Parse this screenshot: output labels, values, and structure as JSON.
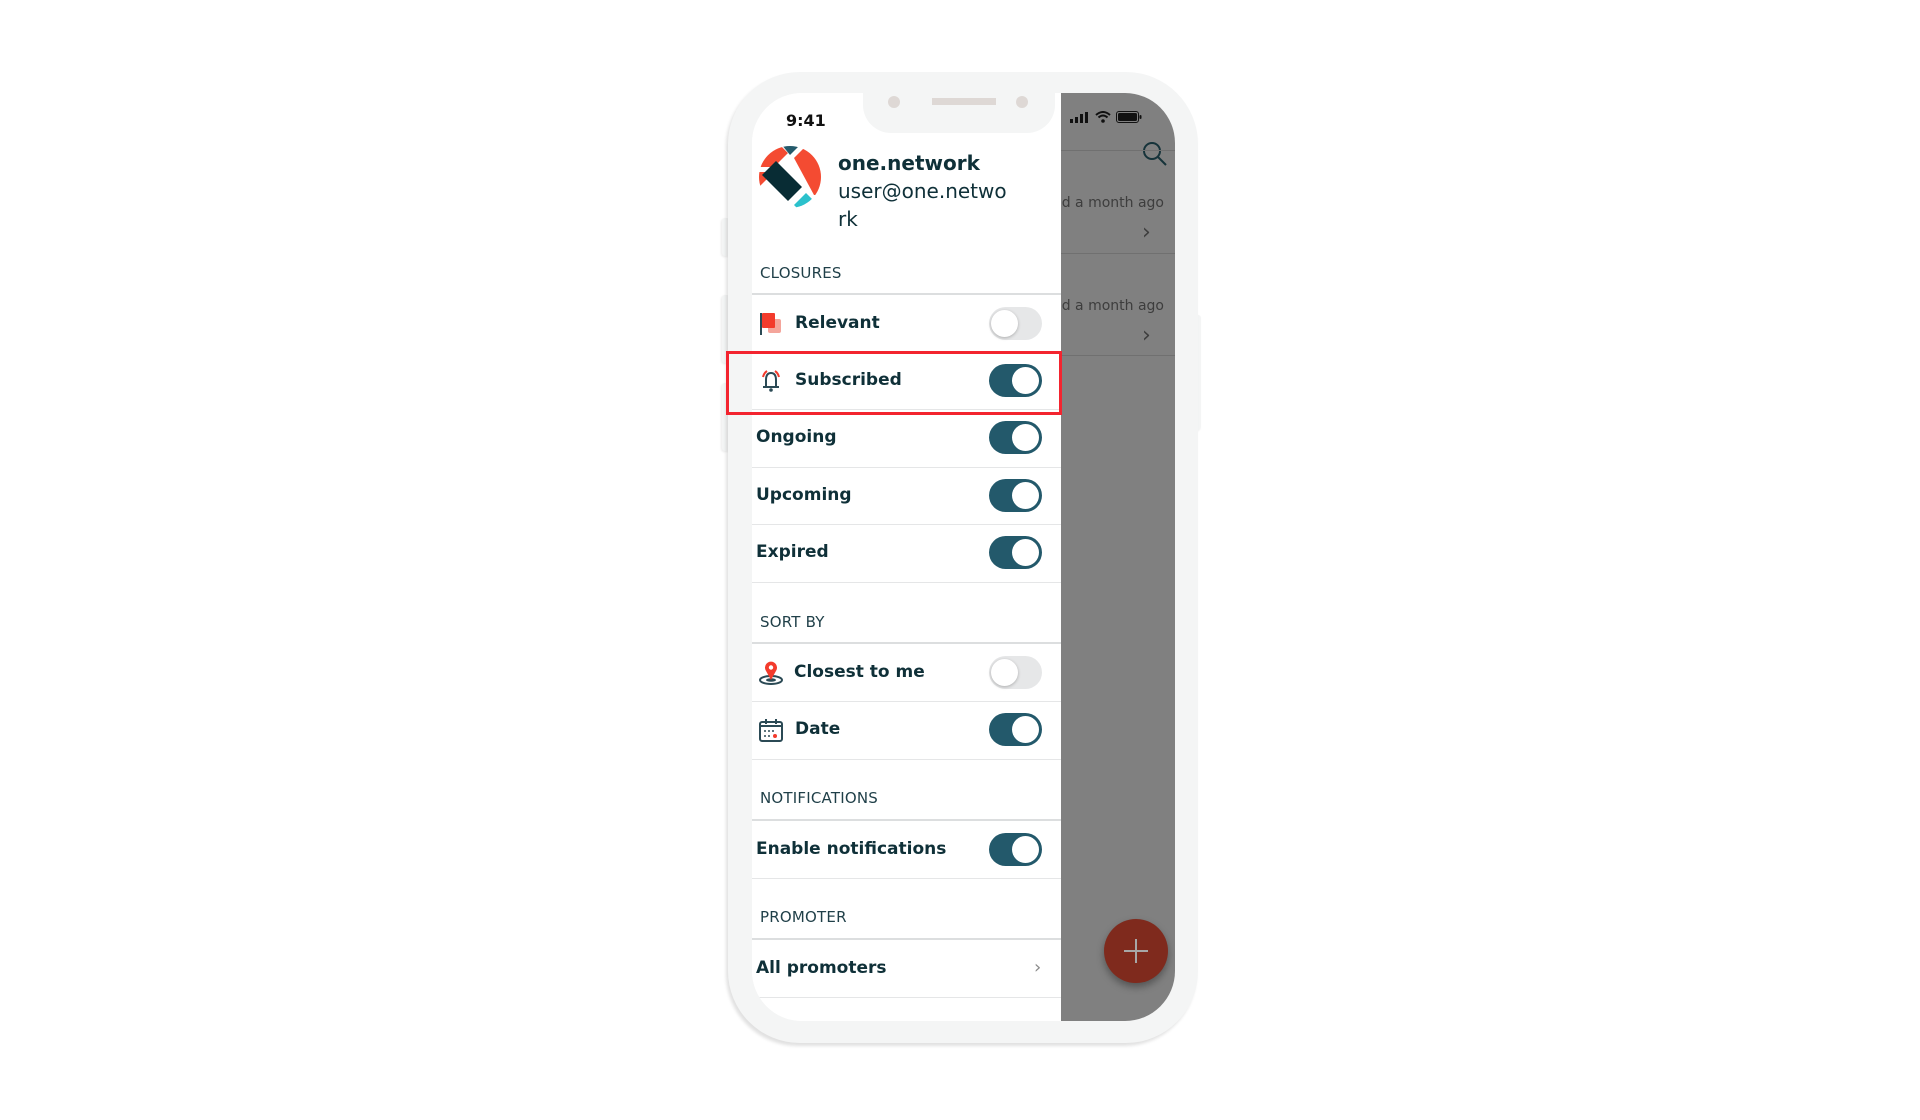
{
  "status_bar": {
    "time": "9:41"
  },
  "profile": {
    "org_name": "one.network",
    "email": "user@one.network"
  },
  "background_list": {
    "items": [
      {
        "text": "Updated a month ago"
      },
      {
        "text": "Updated a month ago"
      }
    ]
  },
  "sections": {
    "closures": {
      "title": "CLOSURES",
      "items": [
        {
          "label": "Relevant",
          "icon": "flag-icon",
          "enabled": false
        },
        {
          "label": "Subscribed",
          "icon": "bell-icon",
          "enabled": true,
          "highlighted": true
        },
        {
          "label": "Ongoing",
          "enabled": true
        },
        {
          "label": "Upcoming",
          "enabled": true
        },
        {
          "label": "Expired",
          "enabled": true
        }
      ]
    },
    "sort_by": {
      "title": "SORT BY",
      "items": [
        {
          "label": "Closest to me",
          "icon": "location-pin-icon",
          "enabled": false
        },
        {
          "label": "Date",
          "icon": "calendar-icon",
          "enabled": true
        }
      ]
    },
    "notifications": {
      "title": "NOTIFICATIONS",
      "items": [
        {
          "label": "Enable notifications",
          "enabled": true
        }
      ]
    },
    "promoter": {
      "title": "PROMOTER",
      "items": [
        {
          "label": "All promoters",
          "type": "link"
        }
      ]
    }
  },
  "colors": {
    "toggle_on": "#23596b",
    "toggle_off": "#e6e7e8",
    "highlight": "#f3242f",
    "fab": "#7f2a1d",
    "text": "#0f3038",
    "logo_red": "#f44b32",
    "logo_dark": "#082c34",
    "logo_teal": "#2bc1cc"
  }
}
